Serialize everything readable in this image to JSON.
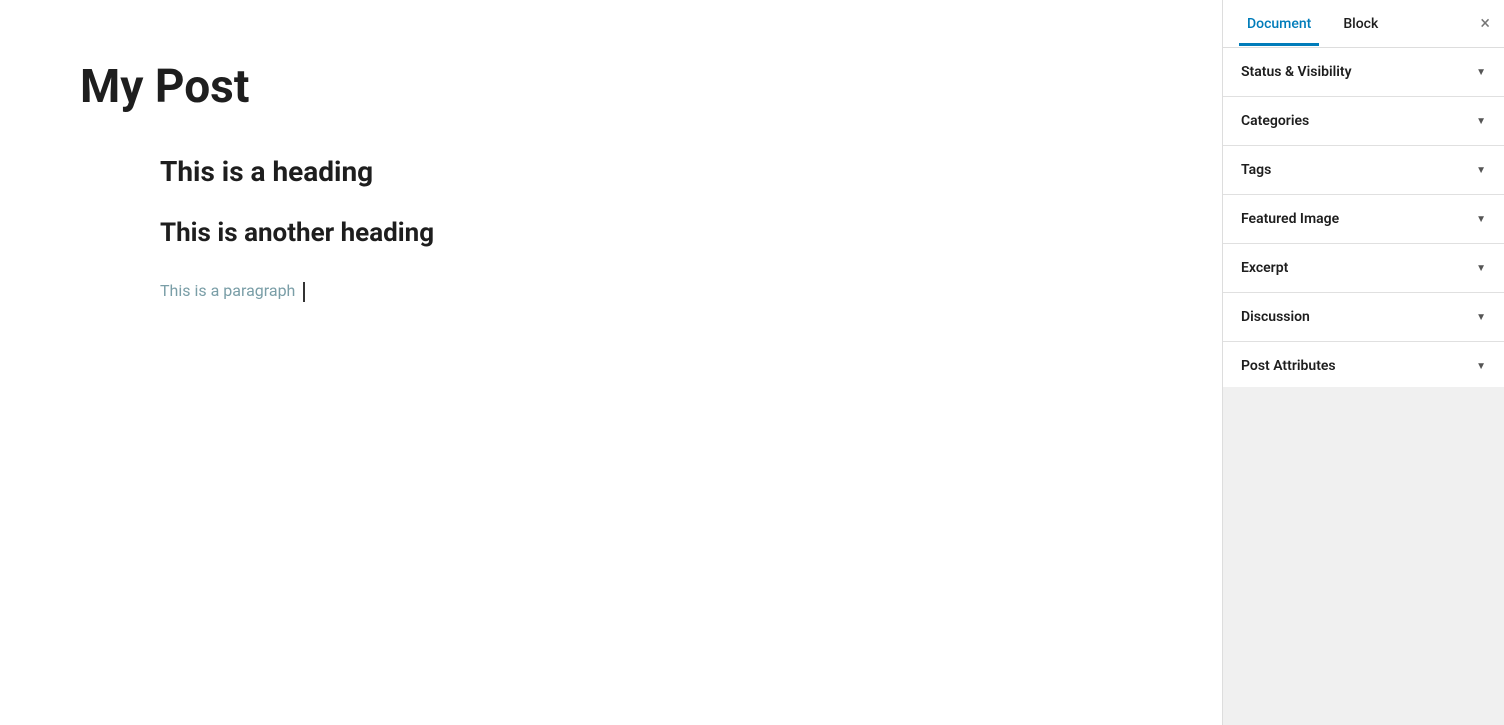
{
  "editor": {
    "post_title": "My Post",
    "content": {
      "heading1": "This is a heading",
      "heading2": "This is another heading",
      "paragraph": "This is a paragraph"
    }
  },
  "sidebar": {
    "tab_document": "Document",
    "tab_block": "Block",
    "close_label": "×",
    "panels": [
      {
        "id": "status-visibility",
        "label": "Status & Visibility"
      },
      {
        "id": "categories",
        "label": "Categories"
      },
      {
        "id": "tags",
        "label": "Tags"
      },
      {
        "id": "featured-image",
        "label": "Featured Image"
      },
      {
        "id": "excerpt",
        "label": "Excerpt"
      },
      {
        "id": "discussion",
        "label": "Discussion"
      },
      {
        "id": "post-attributes",
        "label": "Post Attributes"
      }
    ],
    "chevron": "▼"
  }
}
